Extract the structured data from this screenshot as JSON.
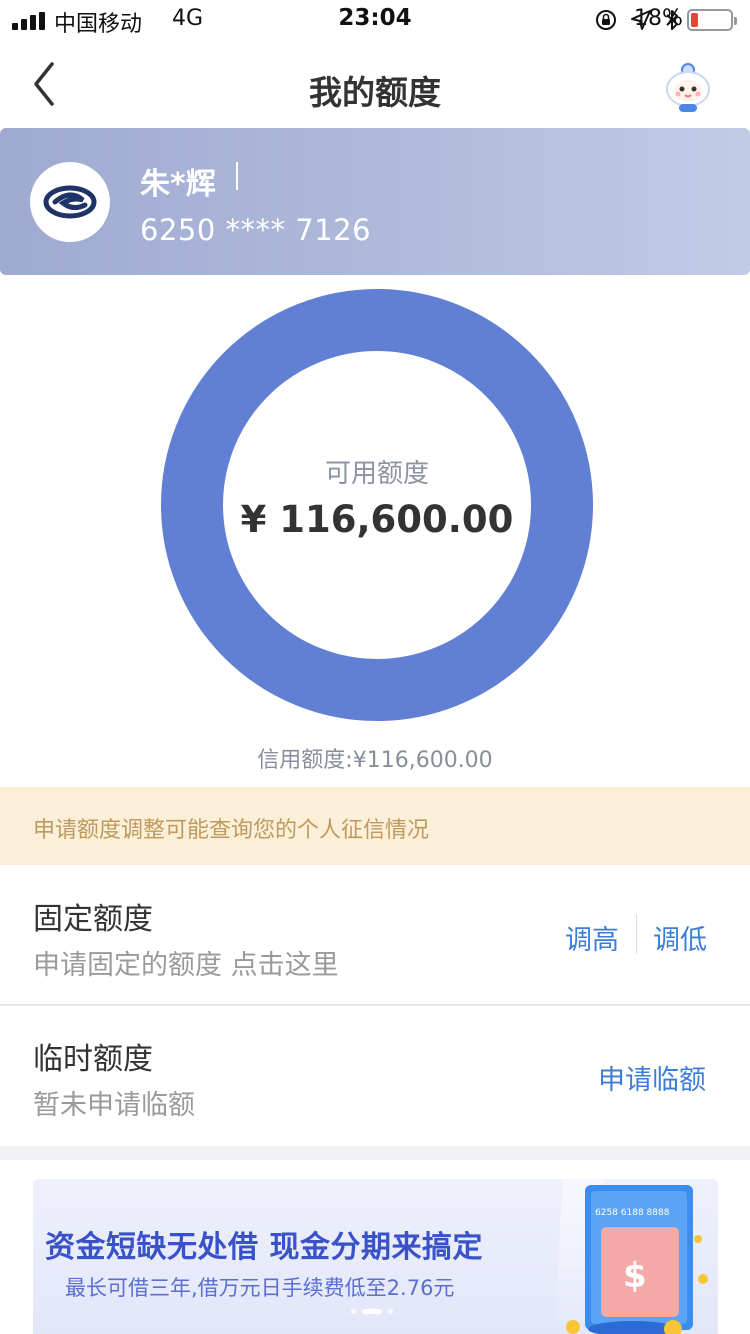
{
  "status_bar": {
    "carrier": "中国移动",
    "network": "4G",
    "time": "23:04",
    "battery_percent": "18%",
    "battery_level": 0.18,
    "battery_color": "#e8423a"
  },
  "nav": {
    "title": "我的额度",
    "back_icon": "chevron-left-icon",
    "assistant_icon": "robot-assistant-icon"
  },
  "card": {
    "holder_name": "朱*辉",
    "number": "6250 **** 7126",
    "bank_icon": "bank-logo-icon"
  },
  "available": {
    "label": "可用额度",
    "amount": "¥ 116,600.00",
    "ratio": 1.0,
    "ring_color": "#6180d3"
  },
  "credit_limit": {
    "label": "信用额度:",
    "amount": "¥116,600.00"
  },
  "notice": {
    "text": "申请额度调整可能查询您的个人征信情况"
  },
  "fixed_quota": {
    "title": "固定额度",
    "subtitle": "申请固定的额度 点击这里",
    "increase_label": "调高",
    "decrease_label": "调低"
  },
  "temp_quota": {
    "title": "临时额度",
    "subtitle": "暂未申请临额",
    "apply_label": "申请临额"
  },
  "ad": {
    "headline": "资金短缺无处借 现金分期来搞定",
    "subline": "最长可借三年,借万元日手续费低至2.76元",
    "card_text": "6258 6188 8888",
    "slide_count": 3,
    "active_slide": 2
  },
  "colors": {
    "accent_blue": "#3c7ed6",
    "ring_blue": "#6180d3",
    "notice_bg": "#fbefd8",
    "notice_text": "#be9a5f"
  }
}
